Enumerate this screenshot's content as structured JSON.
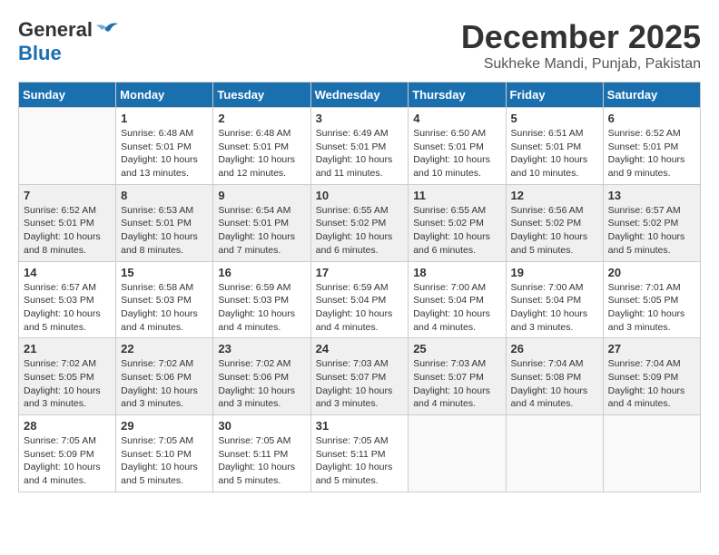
{
  "header": {
    "logo_line1": "General",
    "logo_line2": "Blue",
    "month": "December 2025",
    "location": "Sukheke Mandi, Punjab, Pakistan"
  },
  "weekdays": [
    "Sunday",
    "Monday",
    "Tuesday",
    "Wednesday",
    "Thursday",
    "Friday",
    "Saturday"
  ],
  "weeks": [
    [
      {
        "day": "",
        "info": ""
      },
      {
        "day": "1",
        "info": "Sunrise: 6:48 AM\nSunset: 5:01 PM\nDaylight: 10 hours\nand 13 minutes."
      },
      {
        "day": "2",
        "info": "Sunrise: 6:48 AM\nSunset: 5:01 PM\nDaylight: 10 hours\nand 12 minutes."
      },
      {
        "day": "3",
        "info": "Sunrise: 6:49 AM\nSunset: 5:01 PM\nDaylight: 10 hours\nand 11 minutes."
      },
      {
        "day": "4",
        "info": "Sunrise: 6:50 AM\nSunset: 5:01 PM\nDaylight: 10 hours\nand 10 minutes."
      },
      {
        "day": "5",
        "info": "Sunrise: 6:51 AM\nSunset: 5:01 PM\nDaylight: 10 hours\nand 10 minutes."
      },
      {
        "day": "6",
        "info": "Sunrise: 6:52 AM\nSunset: 5:01 PM\nDaylight: 10 hours\nand 9 minutes."
      }
    ],
    [
      {
        "day": "7",
        "info": "Sunrise: 6:52 AM\nSunset: 5:01 PM\nDaylight: 10 hours\nand 8 minutes."
      },
      {
        "day": "8",
        "info": "Sunrise: 6:53 AM\nSunset: 5:01 PM\nDaylight: 10 hours\nand 8 minutes."
      },
      {
        "day": "9",
        "info": "Sunrise: 6:54 AM\nSunset: 5:01 PM\nDaylight: 10 hours\nand 7 minutes."
      },
      {
        "day": "10",
        "info": "Sunrise: 6:55 AM\nSunset: 5:02 PM\nDaylight: 10 hours\nand 6 minutes."
      },
      {
        "day": "11",
        "info": "Sunrise: 6:55 AM\nSunset: 5:02 PM\nDaylight: 10 hours\nand 6 minutes."
      },
      {
        "day": "12",
        "info": "Sunrise: 6:56 AM\nSunset: 5:02 PM\nDaylight: 10 hours\nand 5 minutes."
      },
      {
        "day": "13",
        "info": "Sunrise: 6:57 AM\nSunset: 5:02 PM\nDaylight: 10 hours\nand 5 minutes."
      }
    ],
    [
      {
        "day": "14",
        "info": "Sunrise: 6:57 AM\nSunset: 5:03 PM\nDaylight: 10 hours\nand 5 minutes."
      },
      {
        "day": "15",
        "info": "Sunrise: 6:58 AM\nSunset: 5:03 PM\nDaylight: 10 hours\nand 4 minutes."
      },
      {
        "day": "16",
        "info": "Sunrise: 6:59 AM\nSunset: 5:03 PM\nDaylight: 10 hours\nand 4 minutes."
      },
      {
        "day": "17",
        "info": "Sunrise: 6:59 AM\nSunset: 5:04 PM\nDaylight: 10 hours\nand 4 minutes."
      },
      {
        "day": "18",
        "info": "Sunrise: 7:00 AM\nSunset: 5:04 PM\nDaylight: 10 hours\nand 4 minutes."
      },
      {
        "day": "19",
        "info": "Sunrise: 7:00 AM\nSunset: 5:04 PM\nDaylight: 10 hours\nand 3 minutes."
      },
      {
        "day": "20",
        "info": "Sunrise: 7:01 AM\nSunset: 5:05 PM\nDaylight: 10 hours\nand 3 minutes."
      }
    ],
    [
      {
        "day": "21",
        "info": "Sunrise: 7:02 AM\nSunset: 5:05 PM\nDaylight: 10 hours\nand 3 minutes."
      },
      {
        "day": "22",
        "info": "Sunrise: 7:02 AM\nSunset: 5:06 PM\nDaylight: 10 hours\nand 3 minutes."
      },
      {
        "day": "23",
        "info": "Sunrise: 7:02 AM\nSunset: 5:06 PM\nDaylight: 10 hours\nand 3 minutes."
      },
      {
        "day": "24",
        "info": "Sunrise: 7:03 AM\nSunset: 5:07 PM\nDaylight: 10 hours\nand 3 minutes."
      },
      {
        "day": "25",
        "info": "Sunrise: 7:03 AM\nSunset: 5:07 PM\nDaylight: 10 hours\nand 4 minutes."
      },
      {
        "day": "26",
        "info": "Sunrise: 7:04 AM\nSunset: 5:08 PM\nDaylight: 10 hours\nand 4 minutes."
      },
      {
        "day": "27",
        "info": "Sunrise: 7:04 AM\nSunset: 5:09 PM\nDaylight: 10 hours\nand 4 minutes."
      }
    ],
    [
      {
        "day": "28",
        "info": "Sunrise: 7:05 AM\nSunset: 5:09 PM\nDaylight: 10 hours\nand 4 minutes."
      },
      {
        "day": "29",
        "info": "Sunrise: 7:05 AM\nSunset: 5:10 PM\nDaylight: 10 hours\nand 5 minutes."
      },
      {
        "day": "30",
        "info": "Sunrise: 7:05 AM\nSunset: 5:11 PM\nDaylight: 10 hours\nand 5 minutes."
      },
      {
        "day": "31",
        "info": "Sunrise: 7:05 AM\nSunset: 5:11 PM\nDaylight: 10 hours\nand 5 minutes."
      },
      {
        "day": "",
        "info": ""
      },
      {
        "day": "",
        "info": ""
      },
      {
        "day": "",
        "info": ""
      }
    ]
  ]
}
